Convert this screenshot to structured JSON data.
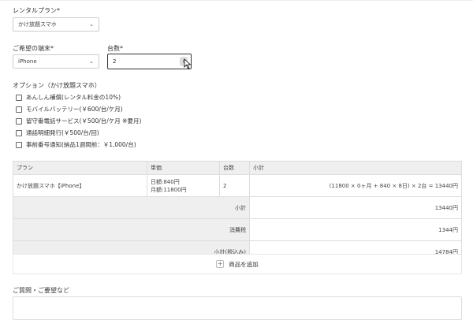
{
  "rental_plan": {
    "label": "レンタルプラン*",
    "selected": "かけ放題スマホ"
  },
  "device": {
    "label": "ご希望の端末*",
    "selected": "iPhone"
  },
  "quantity": {
    "label": "台数*",
    "value": "2"
  },
  "options": {
    "title": "オプション（かけ放題スマホ）",
    "items": [
      {
        "label": "あんしん補償(レンタル料金の10%)"
      },
      {
        "label": "モバイルバッテリー(￥600/台/ケ月)"
      },
      {
        "label": "留守番電話サービス(￥500/台/ケ月 ※要月)"
      },
      {
        "label": "通話明細発行(￥500/台/回)"
      },
      {
        "label": "事前番号通知(納品1週間前：￥1,000/台)"
      }
    ]
  },
  "table": {
    "headers": [
      "プラン",
      "単価",
      "台数",
      "小計"
    ],
    "row": {
      "plan": "かけ放題スマホ【iPhone】",
      "price_day": "日額:840円",
      "price_month": "月額:11800円",
      "qty": "2",
      "subtotal": "(11800 × 0ヶ月 + 840 × 8日) × 2台 = 13440円"
    },
    "summary": [
      {
        "label": "小計",
        "value": "13440円"
      },
      {
        "label": "消費税",
        "value": "1344円"
      },
      {
        "label": "小計(税込み)",
        "value": "14784円"
      }
    ]
  },
  "add_button": {
    "label": "商品を追加"
  },
  "inquiry": {
    "label": "ご質問・ご要望など"
  }
}
